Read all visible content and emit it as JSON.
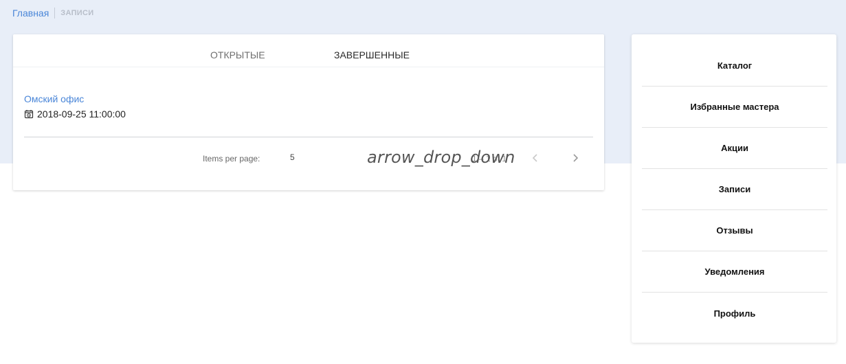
{
  "breadcrumb": {
    "home": "Главная",
    "current": "ЗАПИСИ"
  },
  "tabs": [
    {
      "label": "ОТКРЫТЫЕ",
      "active": false
    },
    {
      "label": "ЗАВЕРШЕННЫЕ",
      "active": true
    }
  ],
  "record": {
    "title": "Омский офис",
    "datetime": "2018-09-25 11:00:00",
    "icon": "calendar-clock-icon"
  },
  "paginator": {
    "items_per_page_label": "Items per page:",
    "items_per_page_value": "5",
    "dropdown_icon_text": "arrow_drop_down",
    "range_label": "1 – 1 of 1",
    "prev_icon": "chevron-left-icon",
    "next_icon": "chevron-right-icon"
  },
  "menu": [
    {
      "label": "Каталог"
    },
    {
      "label": "Избранные мастера"
    },
    {
      "label": "Акции"
    },
    {
      "label": "Записи"
    },
    {
      "label": "Отзывы"
    },
    {
      "label": "Уведомления"
    },
    {
      "label": "Профиль"
    }
  ],
  "colors": {
    "link": "#4a86d8",
    "band": "#e8eef8"
  }
}
